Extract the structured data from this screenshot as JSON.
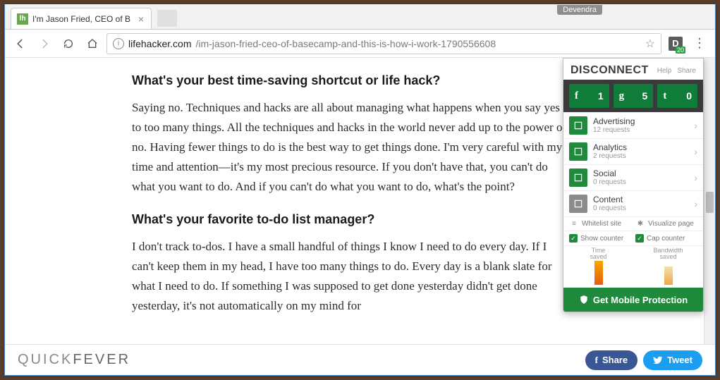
{
  "window": {
    "user_label": "Devendra"
  },
  "tab": {
    "title": "I'm Jason Fried, CEO of B"
  },
  "url": {
    "host": "lifehacker.com",
    "path": "/im-jason-fried-ceo-of-basecamp-and-this-is-how-i-work-1790556608"
  },
  "extension": {
    "badge": "20"
  },
  "article": {
    "h1": "What's your best time-saving shortcut or life hack?",
    "p1": "Saying no. Techniques and hacks are all about managing what happens when you say yes to too many things. All the techniques and hacks in the world never add up to the power of no. Having fewer things to do is the best way to get things done. I'm very careful with my time and attention—it's my most precious resource. If you don't have that, you can't do what you want to do. And if you can't do what you want to do, what's the point?",
    "h2": "What's your favorite to-do list manager?",
    "p2": "I don't track to-dos. I have a small handful of things I know I need to do every day. If I can't keep them in my head, I have too many things to do. Every day is a blank slate for what I need to do. If something I was supposed to get done yesterday didn't get done yesterday, it's not automatically on my mind for"
  },
  "footer": {
    "logo_a": "QUICK",
    "logo_b": "FEVER",
    "share": "Share",
    "tweet": "Tweet"
  },
  "popup": {
    "title": "DISCONNECT",
    "help": "Help",
    "share": "Share",
    "social": {
      "f": "1",
      "g": "5",
      "t": "0"
    },
    "cats": [
      {
        "name": "Advertising",
        "sub": "12 requests",
        "color": "green"
      },
      {
        "name": "Analytics",
        "sub": "2 requests",
        "color": "green"
      },
      {
        "name": "Social",
        "sub": "0 requests",
        "color": "green"
      },
      {
        "name": "Content",
        "sub": "0 requests",
        "color": "grey"
      }
    ],
    "whitelist": "Whitelist site",
    "visualize": "Visualize page",
    "show_counter": "Show counter",
    "cap_counter": "Cap counter",
    "time_saved": "Time\nsaved",
    "bandwidth_saved": "Bandwidth\nsaved",
    "cta": "Get Mobile Protection"
  }
}
